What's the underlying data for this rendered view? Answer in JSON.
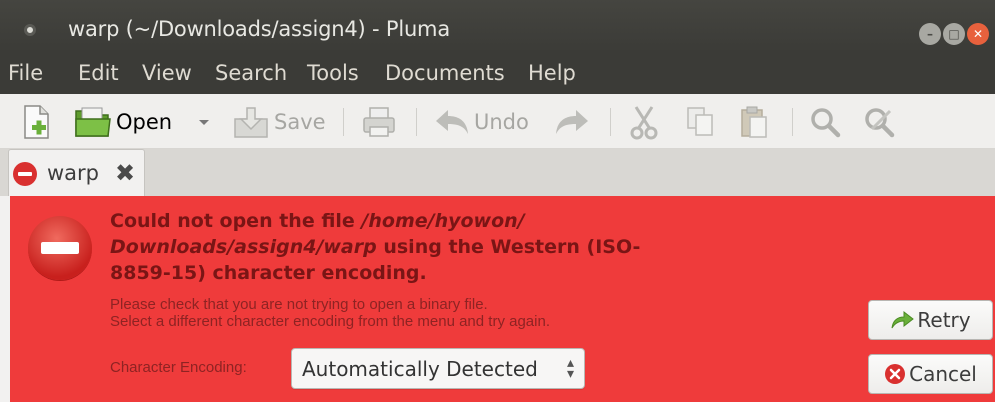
{
  "window": {
    "title": "warp (~/Downloads/assign4) - Pluma",
    "minimize_glyph": "–",
    "maximize_glyph": "□",
    "close_glyph": "✕"
  },
  "menubar": {
    "items": [
      "File",
      "Edit",
      "View",
      "Search",
      "Tools",
      "Documents",
      "Help"
    ]
  },
  "toolbar": {
    "open_label": "Open",
    "save_label": "Save",
    "undo_label": "Undo",
    "icons": [
      "new-document-icon",
      "open-folder-icon",
      "dropdown-arrow-icon",
      "save-icon",
      "print-icon",
      "undo-icon",
      "redo-icon",
      "cut-icon",
      "copy-icon",
      "paste-icon",
      "search-icon",
      "replace-icon"
    ]
  },
  "tab": {
    "label": "warp",
    "close_glyph": "✖"
  },
  "infobar": {
    "title_prefix": "Could not open the file ",
    "title_path": "/home/hyowon/ Downloads/assign4/warp",
    "title_suffix": " using the Western (ISO-8859-15) character encoding.",
    "line1": "Please check that you are not trying to open a binary file.",
    "line2": "Select a different character encoding from the menu and try again.",
    "encoding_label": "Character Encoding:",
    "encoding_value": "Automatically Detected",
    "retry_label": "Retry",
    "cancel_label": "Cancel"
  },
  "colors": {
    "infobar_bg": "#ef3b3b",
    "title_text": "#7a1515",
    "titlebar_bg": "#3b3b37"
  }
}
